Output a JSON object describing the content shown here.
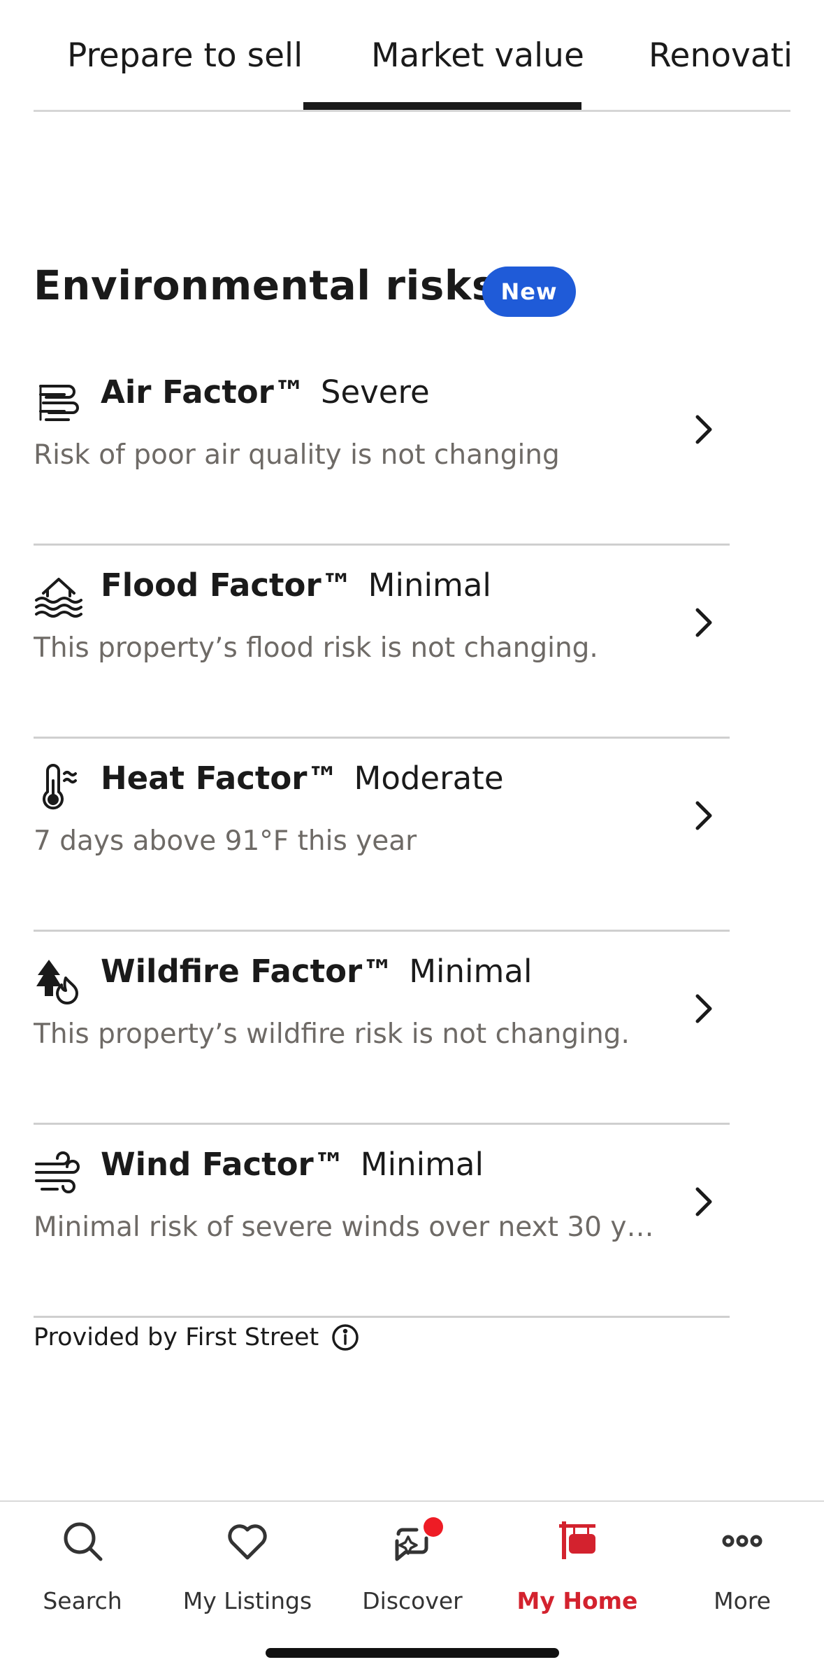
{
  "tabs": [
    {
      "label": "Prepare to sell"
    },
    {
      "label": "Market value",
      "active": true
    },
    {
      "label": "Renovati"
    }
  ],
  "section": {
    "title": "Environmental risks",
    "badge": "New"
  },
  "risks": [
    {
      "name": "Air Factor™",
      "level": "Severe",
      "description": "Risk of poor air quality is not changing",
      "icon": "air-icon"
    },
    {
      "name": "Flood Factor™",
      "level": "Minimal",
      "description": "This property’s flood risk is not changing.",
      "icon": "flood-icon"
    },
    {
      "name": "Heat Factor™",
      "level": "Moderate",
      "description": "7 days above 91°F this year",
      "icon": "thermometer-icon"
    },
    {
      "name": "Wildfire Factor™",
      "level": "Minimal",
      "description": "This property’s wildfire risk is not changing.",
      "icon": "wildfire-icon"
    },
    {
      "name": "Wind Factor™",
      "level": "Minimal",
      "description": "Minimal risk of severe winds over next 30 y…",
      "icon": "wind-icon"
    }
  ],
  "provider": {
    "text": "Provided by First Street"
  },
  "nav": [
    {
      "label": "Search",
      "icon": "search-icon"
    },
    {
      "label": "My Listings",
      "icon": "heart-icon"
    },
    {
      "label": "Discover",
      "icon": "discover-icon"
    },
    {
      "label": "My Home",
      "icon": "home-sign-icon",
      "active": true
    },
    {
      "label": "More",
      "icon": "more-icon"
    }
  ],
  "colors": {
    "accent": "#1f5bd8",
    "active_nav": "#d3222e",
    "notification": "#ee1c25"
  }
}
